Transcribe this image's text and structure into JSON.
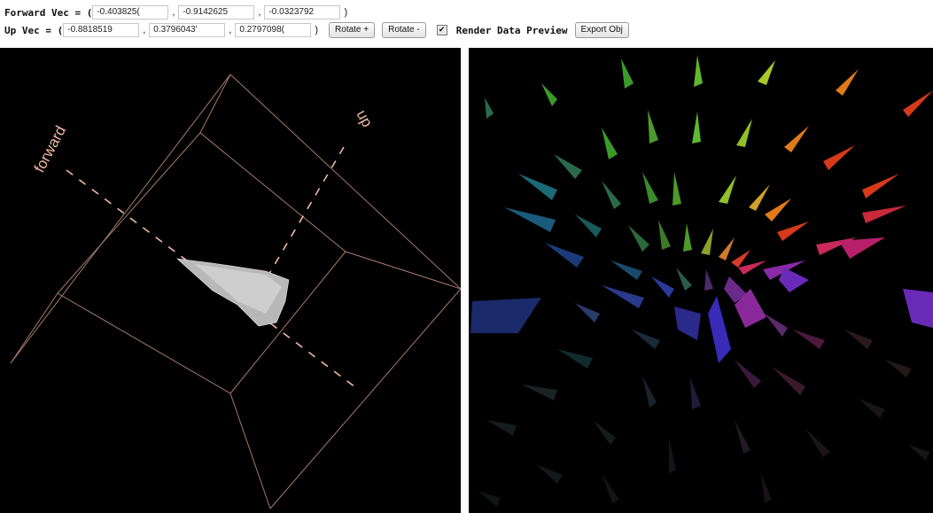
{
  "toolbar": {
    "forward_label": "Forward Vec = (",
    "forward_x": "-0.403825(",
    "forward_y": "-0.9142625",
    "forward_z": "-0.0323792",
    "forward_close": ")",
    "up_label": "Up Vec = (",
    "up_x": "-0.8818519",
    "up_y": "0.3796043'",
    "up_z": "0.2797098(",
    "up_close": ")",
    "rotate_plus_label": "Rotate +",
    "rotate_minus_label": "Rotate -",
    "render_checkbox_checked": true,
    "render_checkbox_mark": "✔",
    "render_label": "Render Data Preview",
    "export_label": "Export Obj"
  },
  "viewport_left": {
    "forward_axis_label": "forward",
    "up_axis_label": "up",
    "axis_color": "#f0b7a3",
    "box_color": "#c48f80"
  },
  "viewport_right": {
    "background": "#000000",
    "glyph_palette": [
      "#3c9a2a",
      "#5fb82d",
      "#a8c72a",
      "#e07a1a",
      "#d63a1a",
      "#b81f6a",
      "#6a2ab8",
      "#2a3ab8",
      "#1a6a7a",
      "#2a6a4a"
    ]
  }
}
